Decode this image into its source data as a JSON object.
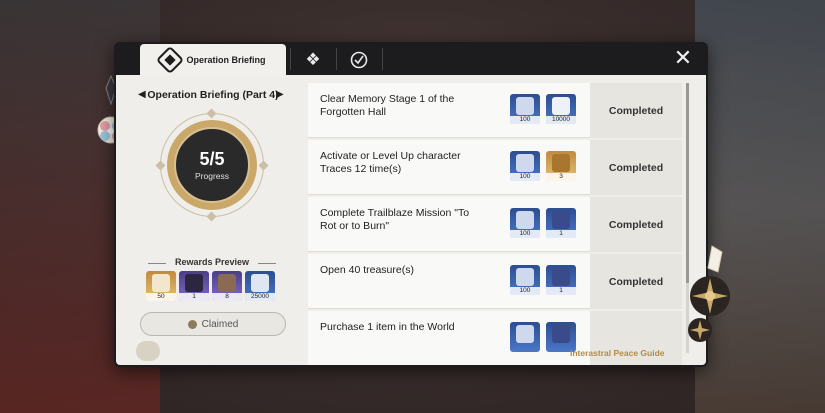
{
  "tabs": [
    {
      "label": "Operation Briefing",
      "icon": "briefing-icon",
      "active": true
    },
    {
      "label": "",
      "icon": "grid-icon",
      "active": false
    },
    {
      "label": "",
      "icon": "target-icon",
      "active": false
    }
  ],
  "left": {
    "title": "Operation Briefing (Part 4)",
    "prev_arrow": "◀",
    "next_arrow": "▶",
    "progress_value": "5/5",
    "progress_label": "Progress",
    "rewards_title": "Rewards Preview",
    "rewards": [
      {
        "qty": "50",
        "icon": "jade-icon",
        "color": "gold"
      },
      {
        "qty": "1",
        "icon": "character-icon",
        "color": "purple"
      },
      {
        "qty": "8",
        "icon": "material-icon",
        "color": "purple"
      },
      {
        "qty": "25000",
        "icon": "credit-icon",
        "color": "blue"
      }
    ],
    "claim_label": "Claimed"
  },
  "tasks": [
    {
      "text": "Clear Memory Stage 1 of the Forgotten Hall",
      "rewards": [
        {
          "qty": "100",
          "color": "blue"
        },
        {
          "qty": "10000",
          "color": "blue"
        }
      ],
      "status": "Completed"
    },
    {
      "text": "Activate or Level Up character Traces 12 time(s)",
      "rewards": [
        {
          "qty": "100",
          "color": "blue"
        },
        {
          "qty": "3",
          "color": "gold"
        }
      ],
      "status": "Completed"
    },
    {
      "text": "Complete Trailblaze Mission \"To Rot or to Burn\"",
      "rewards": [
        {
          "qty": "100",
          "color": "blue"
        },
        {
          "qty": "1",
          "color": "blue"
        }
      ],
      "status": "Completed"
    },
    {
      "text": "Open 40 treasure(s)",
      "rewards": [
        {
          "qty": "100",
          "color": "blue"
        },
        {
          "qty": "1",
          "color": "blue"
        }
      ],
      "status": "Completed"
    },
    {
      "text": "Purchase 1 item in the World",
      "rewards": [
        {
          "qty": "",
          "color": "blue"
        },
        {
          "qty": "",
          "color": "blue"
        }
      ],
      "status": ""
    }
  ],
  "footer": "Interastral Peace Guide",
  "close_icon": "close-icon",
  "colors": {
    "accent": "#b48a48",
    "panel": "#efeeea",
    "dark": "#1c1c1e"
  }
}
